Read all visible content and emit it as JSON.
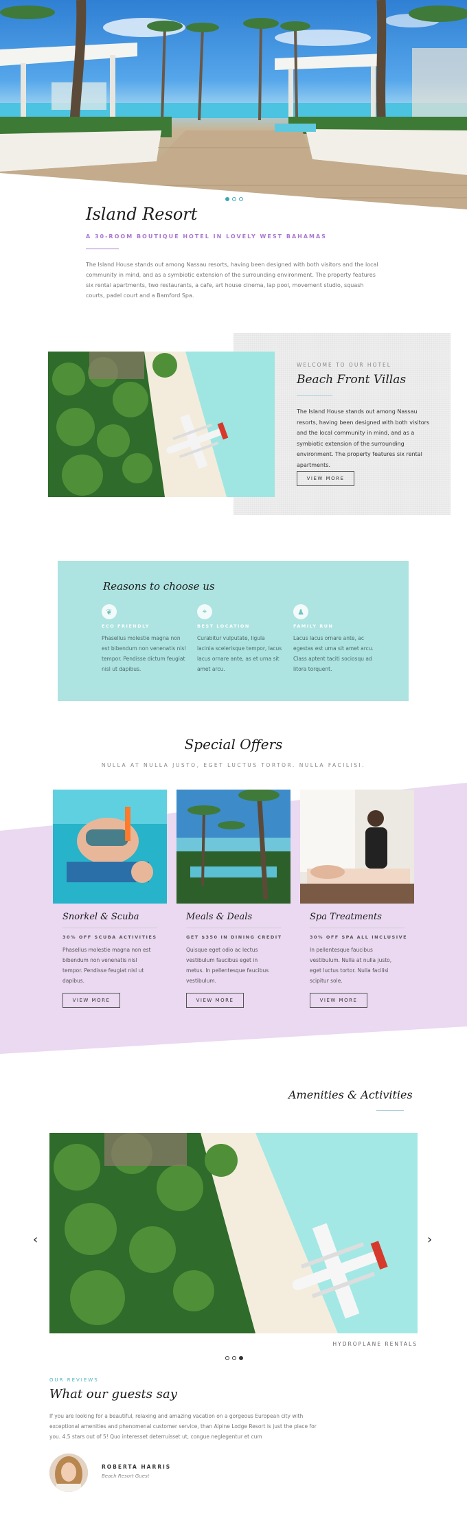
{
  "hero": {
    "image_alt": "Resort cabanas with palm trees and sea view",
    "slides": [
      true,
      false,
      false
    ]
  },
  "intro": {
    "title": "Island Resort",
    "subtitle": "A 30-ROOM BOUTIQUE HOTEL IN LOVELY WEST BAHAMAS",
    "text": "The Island House stands out among Nassau resorts, having been designed with both visitors and the local community in mind, and as a symbiotic extension of the surrounding environment. The property features six rental apartments, two restaurants, a cafe, art house cinema, lap pool, movement studio, squash courts, padel court and a Bamford Spa."
  },
  "villas": {
    "kicker": "WELCOME TO OUR HOTEL",
    "title": "Beach Front Villas",
    "text": "The Island House stands out among Nassau resorts, having been designed with both visitors and the local community in mind, and as a symbiotic extension of the surrounding environment. The property features six rental apartments.",
    "button": "VIEW MORE"
  },
  "reasons": {
    "title": "Reasons to choose us",
    "items": [
      {
        "icon": "leaf-icon",
        "glyph": "❦",
        "title": "ECO FRIENDLY",
        "text": "Phasellus molestie magna non est bibendum non venenatis nisl tempor. Pendisse dictum feugiat nisl ut dapibus."
      },
      {
        "icon": "location-icon",
        "glyph": "⌖",
        "title": "BEST LOCATION",
        "text": "Curabitur vulputate, ligula lacinia scelerisque tempor, lacus lacus ornare ante, as et urna sit amet arcu."
      },
      {
        "icon": "family-icon",
        "glyph": "♟",
        "title": "FAMILY RUN",
        "text": "Lacus lacus ornare ante, ac egestas est urna sit amet arcu. Class aptent taciti sociosqu ad litora torquent."
      }
    ]
  },
  "offers": {
    "title": "Special Offers",
    "subtitle": "NULLA AT NULLA JUSTO, EGET LUCTUS TORTOR. NULLA FACILISI.",
    "accent_color": "#ead9f1",
    "items": [
      {
        "title": "Snorkel & Scuba",
        "kicker": "30% OFF SCUBA ACTIVITIES",
        "text": "Phasellus molestie magna non est bibendum non venenatis nisl tempor. Pendisse feugiat nisl ut dapibus.",
        "button": "VIEW MORE"
      },
      {
        "title": "Meals & Deals",
        "kicker": "GET $350 IN DINING CREDIT",
        "text": "Quisque eget odio ac lectus vestibulum faucibus eget in metus. In pellentesque faucibus vestibulum.",
        "button": "VIEW MORE"
      },
      {
        "title": "Spa Treatments",
        "kicker": "30% OFF SPA ALL INCLUSIVE",
        "text": "In pellentesque faucibus vestibulum. Nulla at nulla justo, eget luctus tortor. Nulla facilisi scipitur sole.",
        "button": "VIEW MORE"
      }
    ]
  },
  "amenities": {
    "title": "Amenities & Activities",
    "caption": "HYDROPLANE RENTALS",
    "prev": "‹",
    "next": "›",
    "slides": [
      false,
      false,
      true
    ]
  },
  "reviews": {
    "kicker": "OUR REVIEWS",
    "title": "What our guests say",
    "text": "If you are looking for a beautiful, relaxing and amazing vacation on a gorgeous European city with exceptional amenities and phenomenal customer service, than Alpine Lodge Resort is just the place for you. 4.5 stars out of 5! Quo interesset deterruisset ut, congue neglegentur et cum",
    "name": "ROBERTA HARRIS",
    "role": "Beach Resort Guest"
  }
}
